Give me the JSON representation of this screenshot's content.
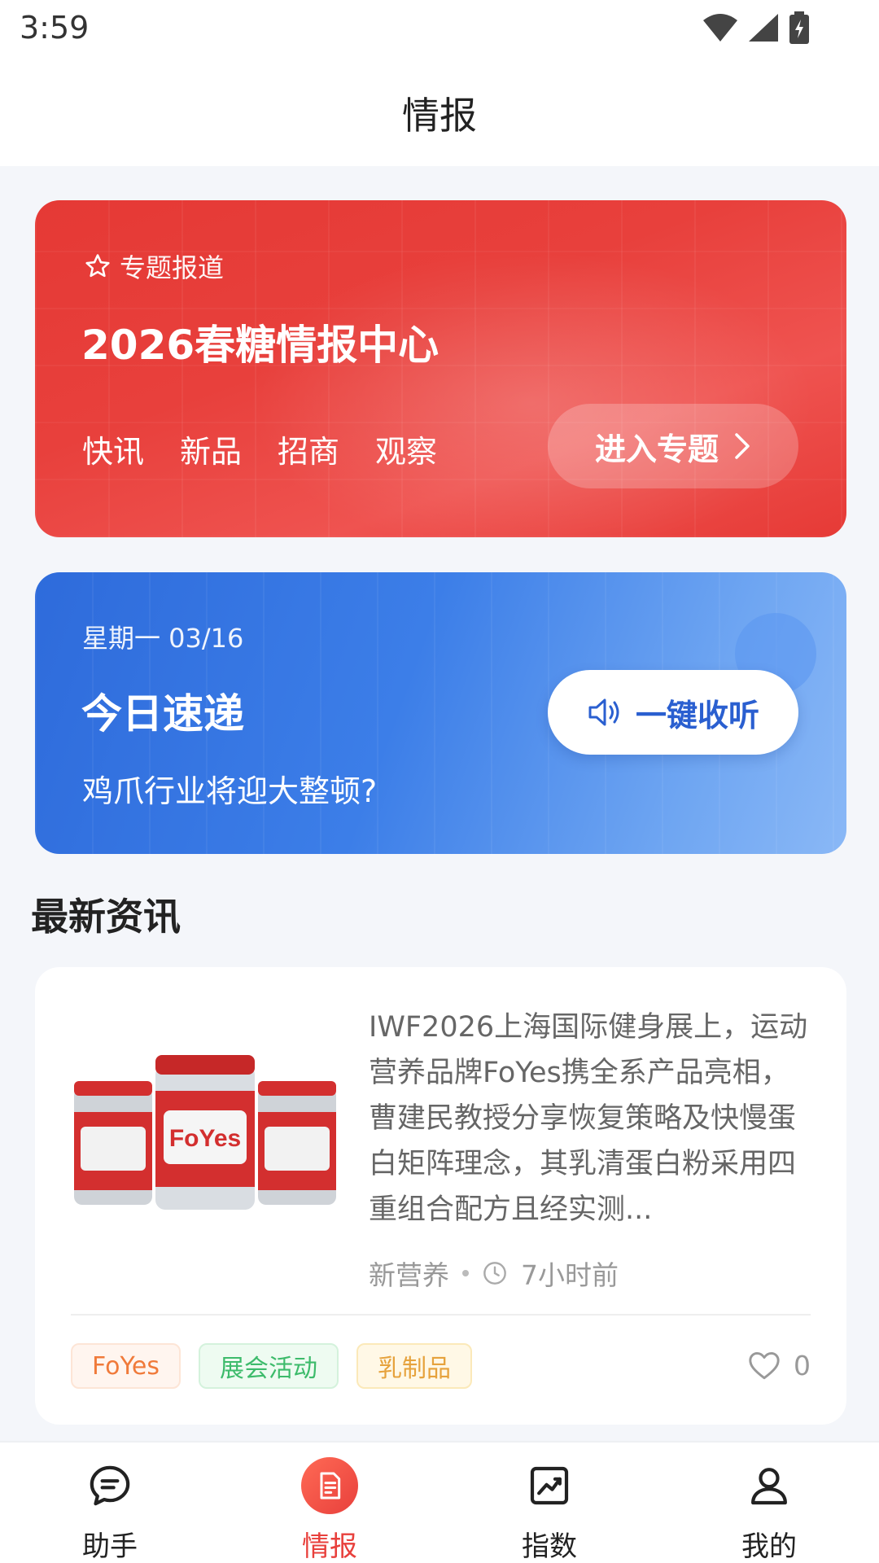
{
  "status": {
    "time": "3:59"
  },
  "header": {
    "title": "情报"
  },
  "topic": {
    "kicker": "专题报道",
    "title": "2026春糖情报中心",
    "tags": [
      "快讯",
      "新品",
      "招商",
      "观察"
    ],
    "enter_label": "进入专题"
  },
  "daily": {
    "date": "星期一 03/16",
    "title": "今日速递",
    "subtitle": "鸡爪行业将迎大整顿?",
    "listen_label": "一键收听"
  },
  "section": {
    "title": "最新资讯"
  },
  "news": [
    {
      "summary": "IWF2026上海国际健身展上，运动营养品牌FoYes携全系产品亮相，曹建民教授分享恢复策略及快慢蛋白矩阵理念，其乳清蛋白粉采用四重组合配方且经实测...",
      "source": "新营养",
      "time": "7小时前",
      "tags": [
        "FoYes",
        "展会活动",
        "乳制品"
      ],
      "likes": "0",
      "product_label": "FoYes"
    }
  ],
  "nav": [
    {
      "label": "助手",
      "icon": "chat-icon"
    },
    {
      "label": "情报",
      "icon": "document-icon"
    },
    {
      "label": "指数",
      "icon": "chart-icon"
    },
    {
      "label": "我的",
      "icon": "user-icon"
    }
  ],
  "colors": {
    "brand_red": "#e8403c",
    "brand_blue": "#2e6bdb"
  }
}
